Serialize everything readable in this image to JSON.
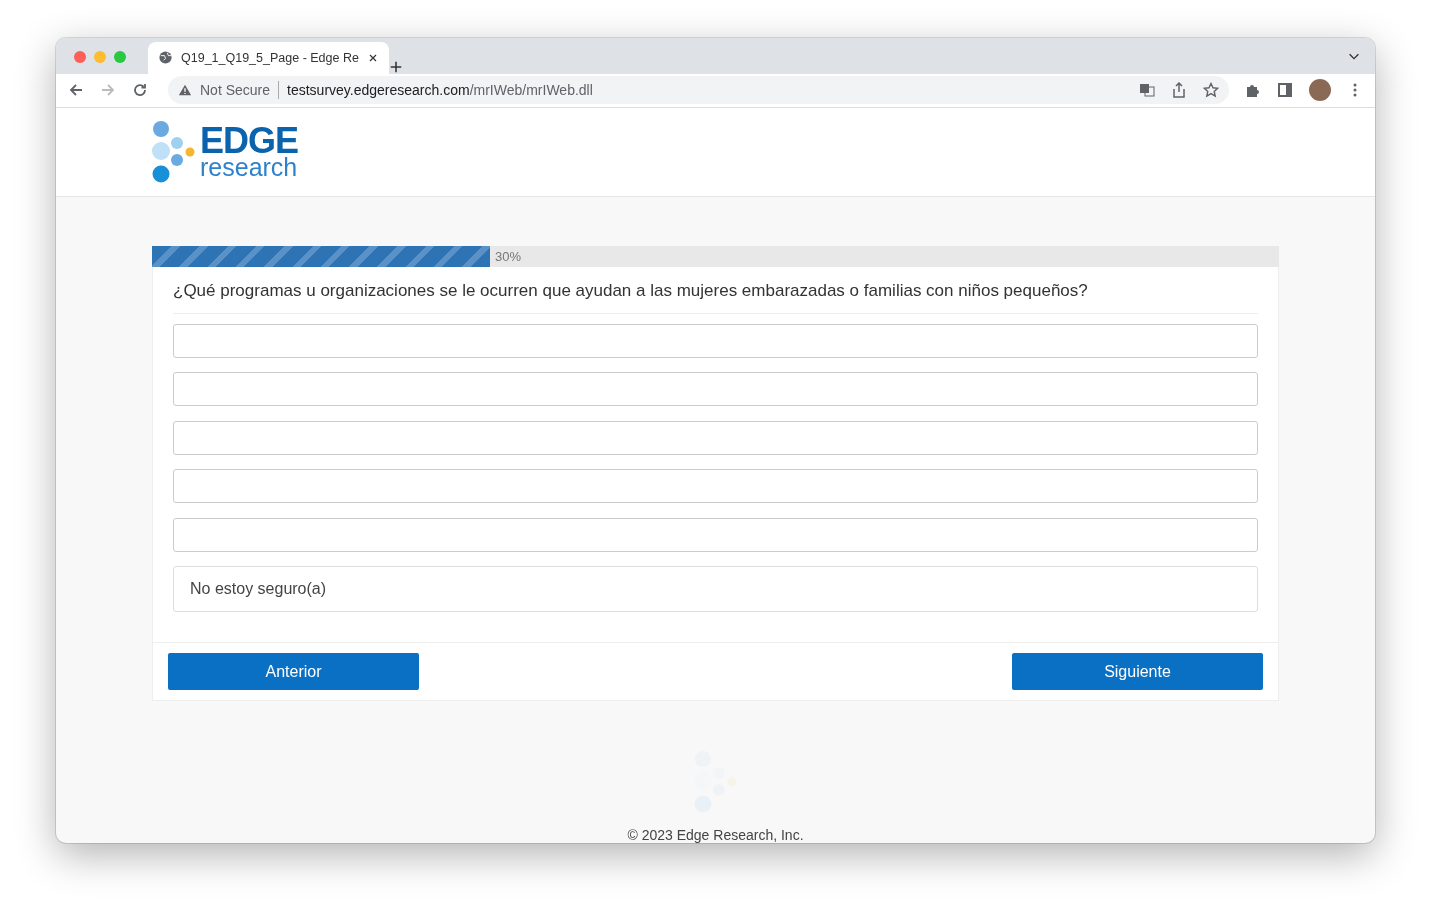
{
  "browser": {
    "tab": {
      "title": "Q19_1_Q19_5_Page - Edge Re",
      "selected": true
    },
    "security": "Not Secure",
    "url_host": "testsurvey.edgeresearch.com",
    "url_path": "/mrIWeb/mrIWeb.dll"
  },
  "logo": {
    "word": "EDGE",
    "subword": "research"
  },
  "progress": {
    "level": 0.3,
    "reading": "30%"
  },
  "question": "¿Qué programas u organizaciones se le ocurren que ayudan a las mujeres embarazadas o familias con niños pequeños?",
  "answers": [
    {
      "kind": "text"
    },
    {
      "kind": "text"
    },
    {
      "kind": "text"
    },
    {
      "kind": "text"
    },
    {
      "kind": "text"
    }
  ],
  "option": {
    "label": "No estoy seguro(a)",
    "selected": false
  },
  "buttons": [
    "Anterior",
    "Siguiente"
  ],
  "footer": "© 2023 Edge Research, Inc."
}
